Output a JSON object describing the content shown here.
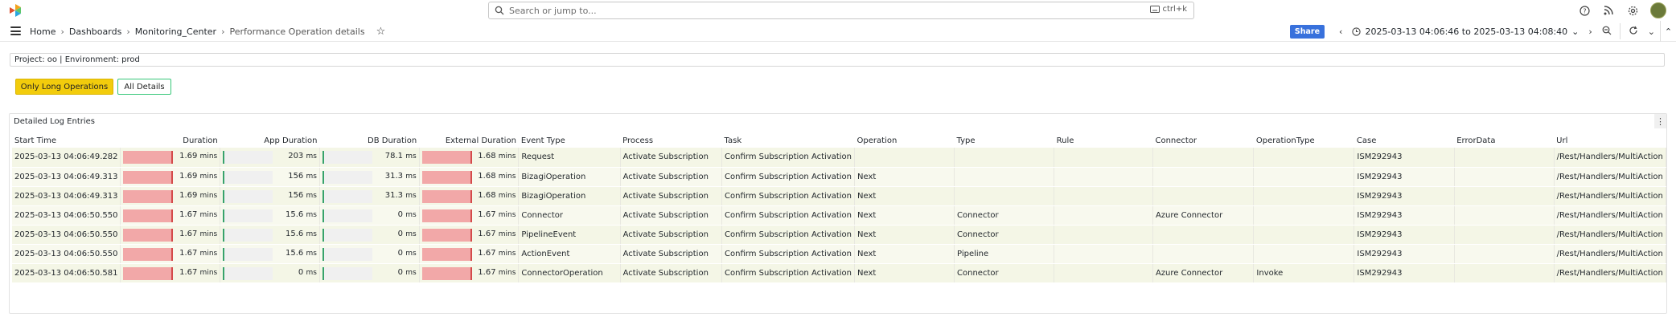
{
  "search": {
    "placeholder": "Search or jump to...",
    "shortcut": "ctrl+k"
  },
  "breadcrumb": {
    "home": "Home",
    "dashboards": "Dashboards",
    "folder": "Monitoring_Center",
    "current": "Performance Operation details"
  },
  "toolbar": {
    "share": "Share",
    "time_range": "2025-03-13 04:06:46 to 2025-03-13 04:08:40"
  },
  "project_line": "Project: oo | Environment: prod",
  "buttons": {
    "only_long": "Only Long Operations",
    "all_details": "All Details"
  },
  "panel": {
    "title": "Detailed Log Entries"
  },
  "columns": [
    "Start Time",
    "Duration",
    "App Duration",
    "DB Duration",
    "External Duration",
    "Event Type",
    "Process",
    "Task",
    "Operation",
    "Type",
    "Rule",
    "Connector",
    "OperationType",
    "Case",
    "ErrorData",
    "Url"
  ],
  "rows": [
    {
      "start": "2025-03-13 04:06:49.282",
      "dur": "1.69",
      "dur_u": "mins",
      "app": "203",
      "app_u": "ms",
      "db": "78.1",
      "db_u": "ms",
      "ext": "1.68",
      "ext_u": "mins",
      "event": "Request",
      "process": "Activate Subscription",
      "task": "Confirm Subscription Activation",
      "operation": "",
      "type": "",
      "rule": "",
      "connector": "",
      "optype": "",
      "case": "ISM292943",
      "error": "",
      "url": "/Rest/Handlers/MultiAction",
      "dur_frac": 1.0,
      "app_frac": 0.0,
      "db_frac": 0.0,
      "ext_frac": 1.0
    },
    {
      "start": "2025-03-13 04:06:49.313",
      "dur": "1.69",
      "dur_u": "mins",
      "app": "156",
      "app_u": "ms",
      "db": "31.3",
      "db_u": "ms",
      "ext": "1.68",
      "ext_u": "mins",
      "event": "BizagiOperation",
      "process": "Activate Subscription",
      "task": "Confirm Subscription Activation",
      "operation": "Next",
      "type": "",
      "rule": "",
      "connector": "",
      "optype": "",
      "case": "ISM292943",
      "error": "",
      "url": "/Rest/Handlers/MultiAction",
      "dur_frac": 1.0,
      "app_frac": 0.0,
      "db_frac": 0.0,
      "ext_frac": 1.0
    },
    {
      "start": "2025-03-13 04:06:49.313",
      "dur": "1.69",
      "dur_u": "mins",
      "app": "156",
      "app_u": "ms",
      "db": "31.3",
      "db_u": "ms",
      "ext": "1.68",
      "ext_u": "mins",
      "event": "BizagiOperation",
      "process": "Activate Subscription",
      "task": "Confirm Subscription Activation",
      "operation": "Next",
      "type": "",
      "rule": "",
      "connector": "",
      "optype": "",
      "case": "ISM292943",
      "error": "",
      "url": "/Rest/Handlers/MultiAction",
      "dur_frac": 1.0,
      "app_frac": 0.0,
      "db_frac": 0.0,
      "ext_frac": 1.0
    },
    {
      "start": "2025-03-13 04:06:50.550",
      "dur": "1.67",
      "dur_u": "mins",
      "app": "15.6",
      "app_u": "ms",
      "db": "0",
      "db_u": "ms",
      "ext": "1.67",
      "ext_u": "mins",
      "event": "Connector",
      "process": "Activate Subscription",
      "task": "Confirm Subscription Activation",
      "operation": "Next",
      "type": "Connector",
      "rule": "",
      "connector": "Azure Connector",
      "optype": "",
      "case": "ISM292943",
      "error": "",
      "url": "/Rest/Handlers/MultiAction",
      "dur_frac": 1.0,
      "app_frac": 0.0,
      "db_frac": 0.0,
      "ext_frac": 1.0
    },
    {
      "start": "2025-03-13 04:06:50.550",
      "dur": "1.67",
      "dur_u": "mins",
      "app": "15.6",
      "app_u": "ms",
      "db": "0",
      "db_u": "ms",
      "ext": "1.67",
      "ext_u": "mins",
      "event": "PipelineEvent",
      "process": "Activate Subscription",
      "task": "Confirm Subscription Activation",
      "operation": "Next",
      "type": "Connector",
      "rule": "",
      "connector": "",
      "optype": "",
      "case": "ISM292943",
      "error": "",
      "url": "/Rest/Handlers/MultiAction",
      "dur_frac": 1.0,
      "app_frac": 0.0,
      "db_frac": 0.0,
      "ext_frac": 1.0
    },
    {
      "start": "2025-03-13 04:06:50.550",
      "dur": "1.67",
      "dur_u": "mins",
      "app": "15.6",
      "app_u": "ms",
      "db": "0",
      "db_u": "ms",
      "ext": "1.67",
      "ext_u": "mins",
      "event": "ActionEvent",
      "process": "Activate Subscription",
      "task": "Confirm Subscription Activation",
      "operation": "Next",
      "type": "Pipeline",
      "rule": "",
      "connector": "",
      "optype": "",
      "case": "ISM292943",
      "error": "",
      "url": "/Rest/Handlers/MultiAction",
      "dur_frac": 1.0,
      "app_frac": 0.0,
      "db_frac": 0.0,
      "ext_frac": 1.0
    },
    {
      "start": "2025-03-13 04:06:50.581",
      "dur": "1.67",
      "dur_u": "mins",
      "app": "0",
      "app_u": "ms",
      "db": "0",
      "db_u": "ms",
      "ext": "1.67",
      "ext_u": "mins",
      "event": "ConnectorOperation",
      "process": "Activate Subscription",
      "task": "Confirm Subscription Activation",
      "operation": "Next",
      "type": "Connector",
      "rule": "",
      "connector": "Azure Connector",
      "optype": "Invoke",
      "case": "ISM292943",
      "error": "",
      "url": "/Rest/Handlers/MultiAction",
      "dur_frac": 1.0,
      "app_frac": 0.0,
      "db_frac": 0.0,
      "ext_frac": 1.0
    }
  ],
  "colors": {
    "accent_blue": "#3871dc",
    "gauge_red": "#f2a8a8",
    "gauge_green": "#37a36b",
    "highlight_yellow": "#f2cc0c",
    "row_bg": "#f4f6e6"
  },
  "icons": [
    "logo-icon",
    "search-icon",
    "keyboard-icon",
    "help-icon",
    "rss-icon",
    "gear-icon",
    "menu-icon",
    "star-icon",
    "chevron-left-icon",
    "clock-icon",
    "chevron-down-icon",
    "chevron-right-icon",
    "zoom-out-icon",
    "refresh-icon",
    "collapse-icon",
    "panel-menu-icon"
  ]
}
